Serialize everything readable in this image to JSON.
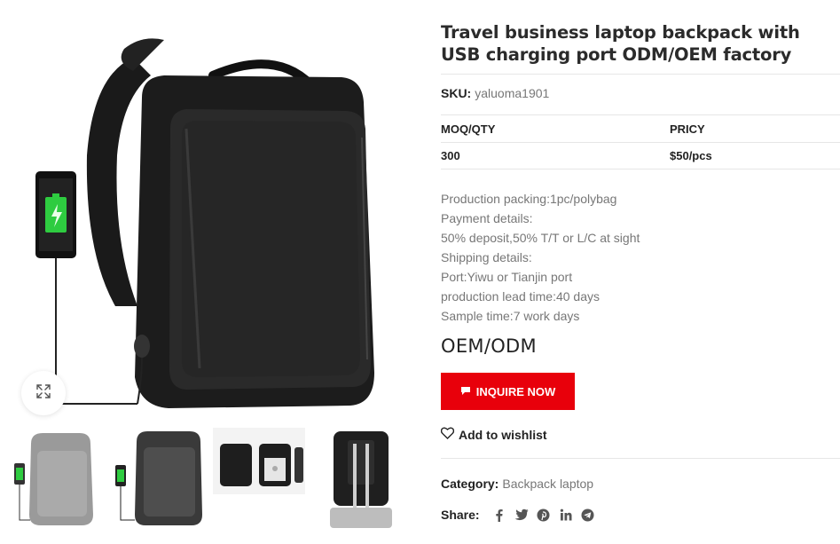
{
  "product": {
    "title": "Travel business laptop backpack with USB charging port ODM/OEM factory",
    "sku_label": "SKU:",
    "sku_value": "yaluoma1901",
    "moq_header": "MOQ/QTY",
    "price_header": "PRICY",
    "moq_value": "300",
    "price_value": "$50/pcs",
    "details": [
      "Production packing:1pc/polybag",
      "Payment details:",
      "50% deposit,50% T/T or L/C at sight",
      "Shipping details:",
      "Port:Yiwu or Tianjin port",
      "production lead time:40 days",
      "Sample time:7 work days"
    ],
    "oem_label": "OEM/ODM",
    "inquire_label": "INQUIRE NOW",
    "wishlist_label": "Add to wishlist",
    "category_label": "Category:",
    "category_value": "Backpack laptop",
    "share_label": "Share:"
  },
  "gallery": {
    "zoom_icon": "expand-icon",
    "thumbnails": [
      "thumb-grey-backpack",
      "thumb-darkgrey-backpack",
      "thumb-backpack-views",
      "thumb-backpack-on-luggage"
    ]
  },
  "share_icons": [
    "facebook-icon",
    "twitter-icon",
    "pinterest-icon",
    "linkedin-icon",
    "telegram-icon"
  ],
  "colors": {
    "accent": "#e8000b",
    "title": "#2b2b2b",
    "muted": "#777777"
  }
}
